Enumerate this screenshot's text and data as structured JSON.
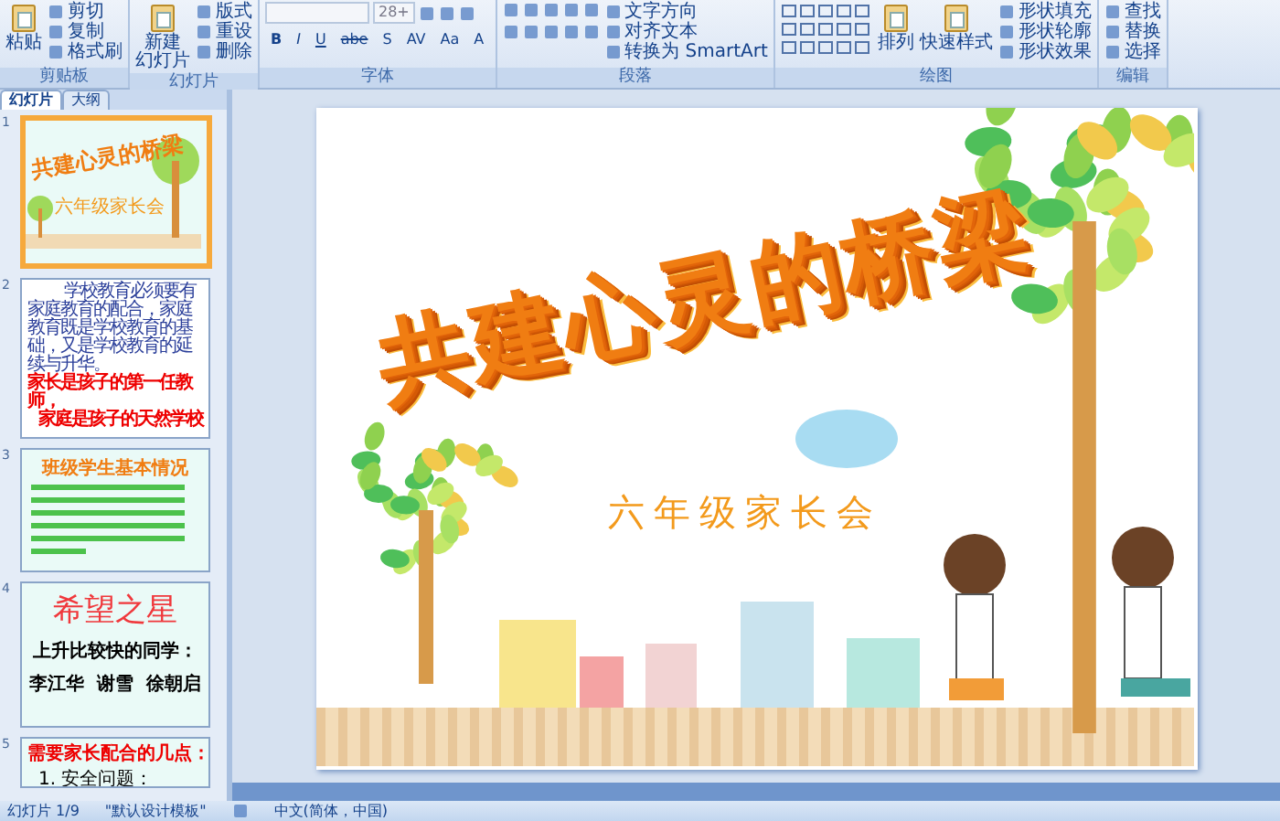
{
  "ribbon": {
    "groups": [
      {
        "kind": "clipboard",
        "label": "剪贴板",
        "large": [
          {
            "lines": [
              "粘贴"
            ]
          }
        ],
        "items": [
          "剪切",
          "复制",
          "格式刷"
        ]
      },
      {
        "kind": "slides",
        "label": "幻灯片",
        "large": [
          {
            "lines": [
              "新建",
              "幻灯片"
            ]
          }
        ],
        "items": [
          "版式",
          "重设",
          "删除"
        ]
      },
      {
        "kind": "font",
        "label": "字体",
        "font_size": "28+",
        "tools": [
          "B",
          "I",
          "U",
          "abe",
          "S",
          "AV",
          "Aa",
          "A"
        ]
      },
      {
        "kind": "paragraph",
        "label": "段落",
        "items": [
          "文字方向",
          "对齐文本",
          "转换为 SmartArt"
        ]
      },
      {
        "kind": "drawing",
        "label": "绘图",
        "large": [
          {
            "lines": [
              "排列"
            ]
          },
          {
            "lines": [
              "快速样式"
            ]
          }
        ],
        "items": [
          "形状填充",
          "形状轮廓",
          "形状效果"
        ]
      },
      {
        "kind": "editing",
        "label": "编辑",
        "items": [
          "查找",
          "替换",
          "选择"
        ]
      }
    ]
  },
  "pane": {
    "tabs": [
      {
        "label": "幻灯片",
        "selected": true
      },
      {
        "label": "大纲",
        "selected": false
      }
    ],
    "thumbnails": [
      {
        "number": "1",
        "selected": true,
        "kind": "cover",
        "title": "共建心灵的桥梁",
        "subtitle": "六年级家长会"
      },
      {
        "number": "2",
        "selected": false,
        "kind": "text",
        "body": "学校教育必须要有家庭教育的配合，家庭教育既是学校教育的基础，又是学校教育的延续与升华。",
        "highlights": [
          "家长是孩子的第一任教师，",
          "家庭是孩子的天然学校"
        ]
      },
      {
        "number": "3",
        "selected": false,
        "kind": "list",
        "title": "班级学生基本情况"
      },
      {
        "number": "4",
        "selected": false,
        "kind": "stars",
        "title": "希望之星",
        "lines": [
          "上升比较快的同学：",
          "李江华  谢雪  徐朝启"
        ]
      },
      {
        "number": "5",
        "selected": false,
        "kind": "points",
        "title": "需要家长配合的几点：",
        "lines": [
          "1. 安全问题："
        ]
      }
    ]
  },
  "slide": {
    "title": "共建心灵的桥梁",
    "subtitle": "六年级家长会"
  },
  "status_bar": {
    "slide": "幻灯片 1/9",
    "theme": "\"默认设计模板\"",
    "language": "中文(简体，中国)"
  }
}
